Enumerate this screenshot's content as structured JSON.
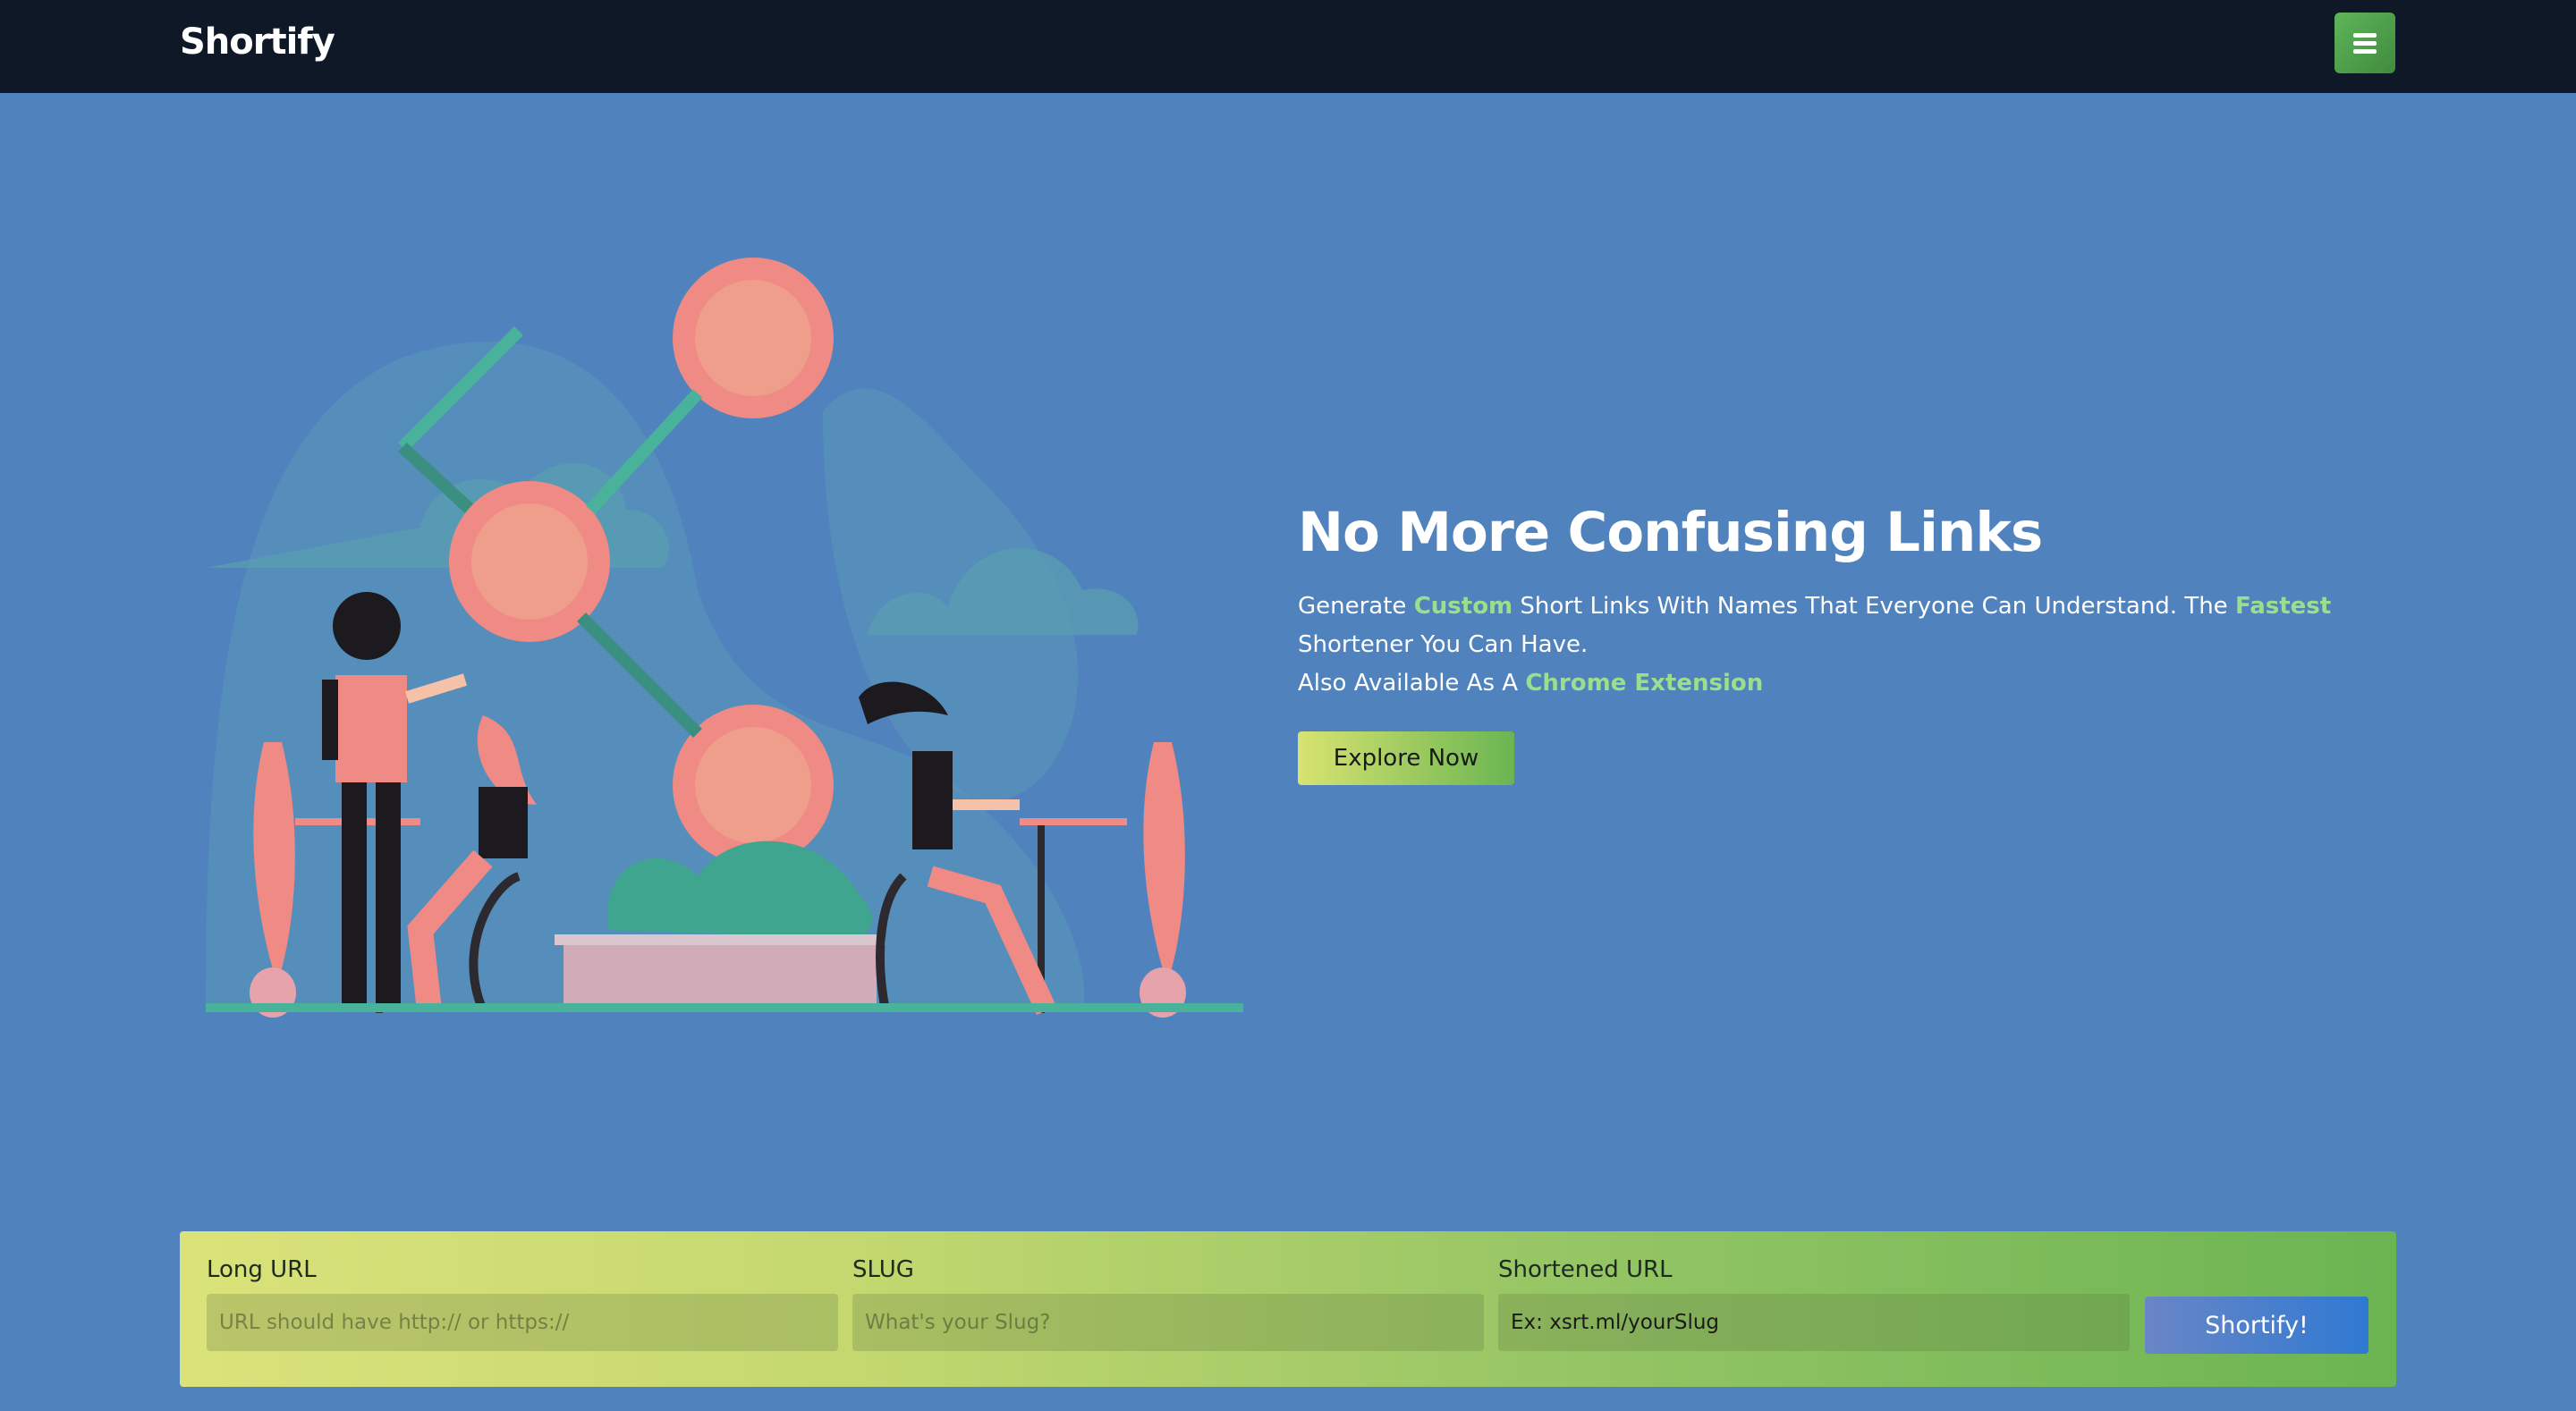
{
  "navbar": {
    "brand": "Shortify",
    "menu_icon": "hamburger-icon"
  },
  "hero": {
    "title": "No More Confusing Links",
    "line1_a": "Generate ",
    "line1_hl1": "Custom",
    "line1_b": " Short Links With Names That Everyone Can Understand. The ",
    "line1_hl2": "Fastest",
    "line1_c": " Shortener You Can Have.",
    "line2_a": "Also Available As A ",
    "line2_hl": "Chrome Extension",
    "cta_label": "Explore Now"
  },
  "form": {
    "long_url": {
      "label": "Long URL",
      "placeholder": "URL should have http:// or https://"
    },
    "slug": {
      "label": "SLUG",
      "placeholder": "What's your Slug?"
    },
    "shortened": {
      "label": "Shortened URL",
      "placeholder": "Ex: xsrt.ml/yourSlug"
    },
    "submit_label": "Shortify!"
  },
  "colors": {
    "navbar_bg": "#0e1826",
    "page_bg": "#5083bd",
    "highlight": "#9bde8e",
    "menu_button": "#4f9f4b",
    "submit_button": "#2f79d2"
  }
}
